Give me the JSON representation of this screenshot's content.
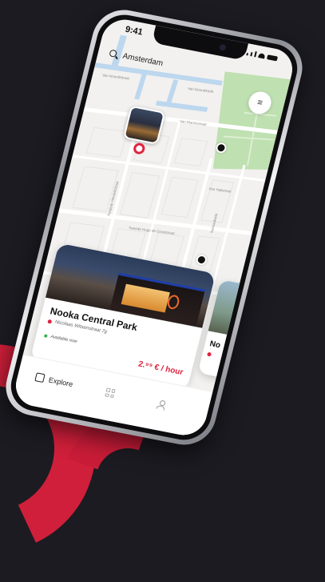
{
  "status": {
    "time": "9:41"
  },
  "search": {
    "value": "Amsterdam"
  },
  "map": {
    "street_labels": [
      "Van Noordtkade",
      "Van Marnixstraat",
      "Van Hallstraat",
      "Tweede Hugo de Grootstraat",
      "Van Noordtstraat",
      "Nassaukade",
      "Frederik Hendrikstraat"
    ]
  },
  "listing": {
    "title": "Nooka Central Park",
    "address": "Nicolaas Witsenstraat 7g",
    "availability": "Available now",
    "price": "2.⁹⁹ € / hour"
  },
  "next_listing": {
    "title_partial": "No"
  },
  "tabbar": {
    "explore": "Explore"
  },
  "colors": {
    "accent": "#e0243f",
    "background": "#1c1b22",
    "park": "#bfe0b0",
    "water": "#bcd7ee"
  }
}
